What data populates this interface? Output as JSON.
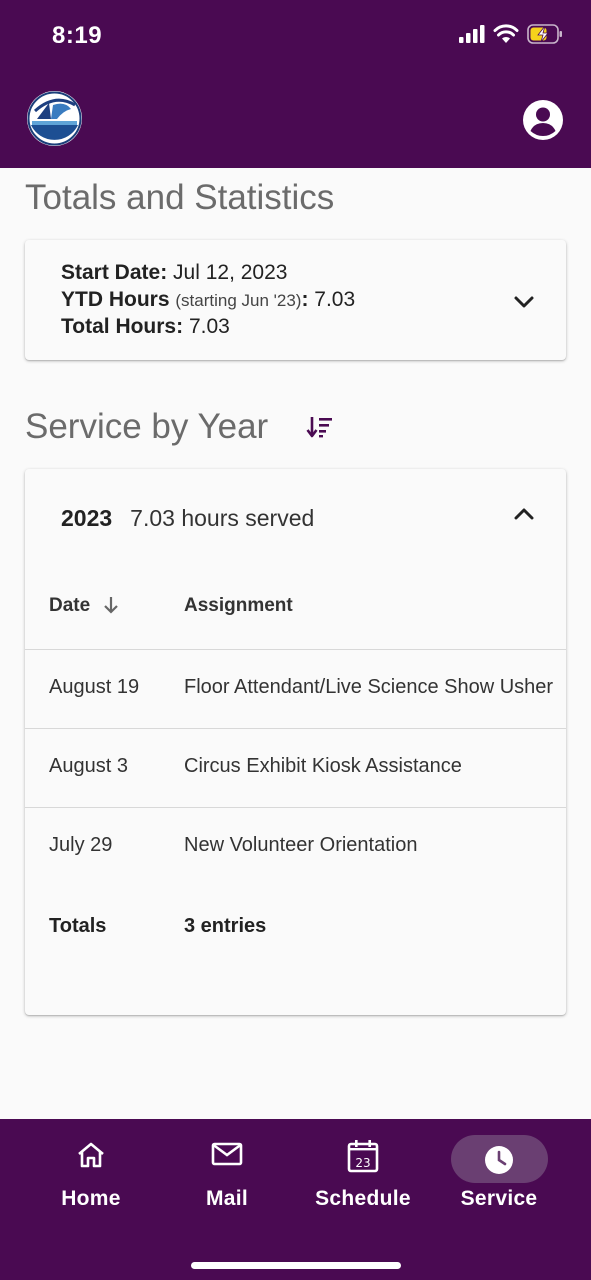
{
  "status_bar": {
    "time": "8:19"
  },
  "colors": {
    "brand_purple": "#4a0a52",
    "accent_icon": "#4a0a52",
    "pill": "#6a3f72"
  },
  "header": {
    "logo_icon": "org-logo-icon",
    "profile_icon": "account-circle-icon"
  },
  "totals_section": {
    "title": "Totals and Statistics",
    "start_date_label": "Start Date:",
    "start_date_value": "Jul 12, 2023",
    "ytd_label": "YTD Hours",
    "ytd_note": "(starting Jun '23)",
    "ytd_colon": ":",
    "ytd_value": "7.03",
    "total_label": "Total Hours:",
    "total_value": "7.03"
  },
  "service_section": {
    "title": "Service by Year",
    "sort_icon": "sort-descending-icon",
    "year": "2023",
    "hours_served": "7.03 hours served",
    "columns": {
      "date": "Date",
      "assignment": "Assignment"
    },
    "rows": [
      {
        "date": "August 19",
        "assignment": "Floor Attendant/Live Science Show Usher"
      },
      {
        "date": "August 3",
        "assignment": "Circus Exhibit Kiosk Assistance"
      },
      {
        "date": "July 29",
        "assignment": "New Volunteer Orientation"
      }
    ],
    "totals_label": "Totals",
    "totals_value": "3 entries"
  },
  "bottom_nav": {
    "items": [
      {
        "label": "Home",
        "icon": "home-icon"
      },
      {
        "label": "Mail",
        "icon": "mail-icon"
      },
      {
        "label": "Schedule",
        "icon": "calendar-icon",
        "icon_text": "23"
      },
      {
        "label": "Service",
        "icon": "clock-icon",
        "active": true
      }
    ]
  }
}
